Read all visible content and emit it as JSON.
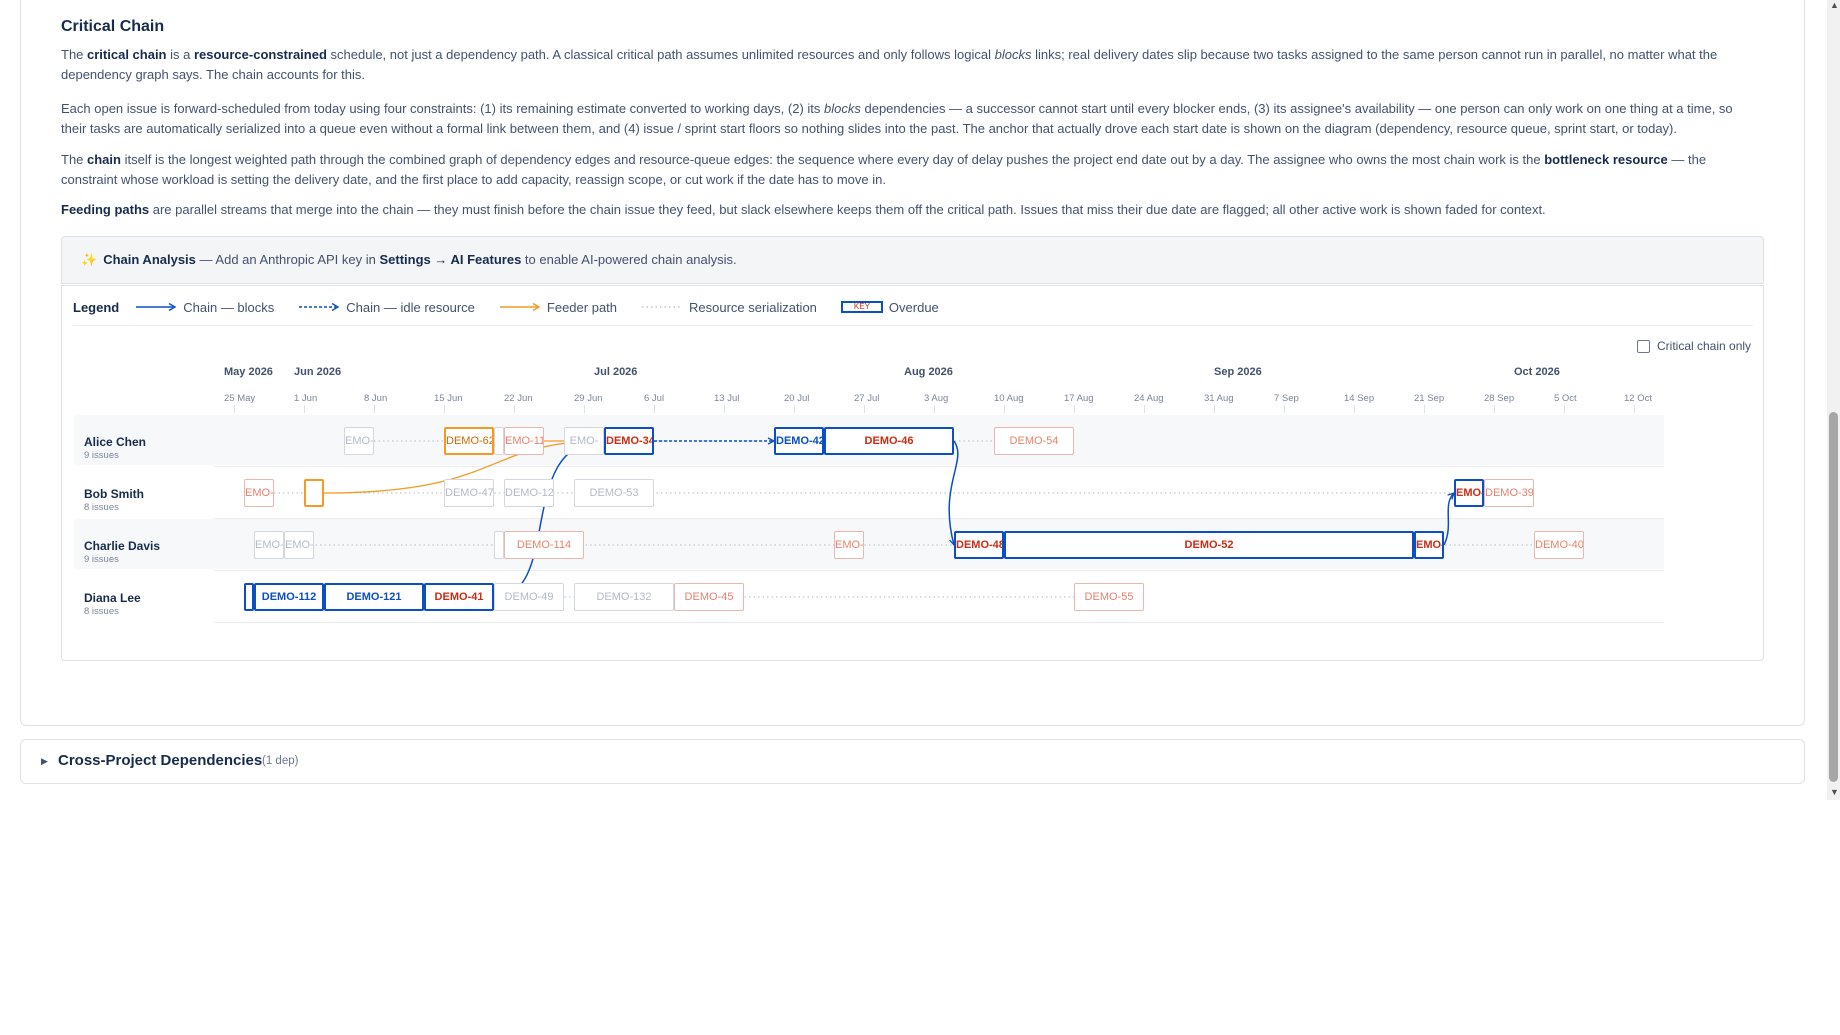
{
  "critical_chain": {
    "title": "Critical Chain",
    "intro": {
      "t1": "The ",
      "b1": "critical chain",
      "t2": " is a ",
      "b2": "resource-constrained",
      "t3": " schedule, not just a dependency path. A classical critical path assumes unlimited resources and only follows logical ",
      "i1": "blocks",
      "t4": " links; real delivery dates slip because two tasks assigned to the same person cannot run in parallel, no matter what the dependency graph says. The chain accounts for this."
    },
    "scheduling": {
      "t1": "Each open issue is forward-scheduled from today using four constraints: (1) its remaining estimate converted to working days, (2) its ",
      "i1": "blocks",
      "t2": " dependencies — a successor cannot start until every blocker ends, (3) its assignee's availability — one person can only work on one thing at a time, so their tasks are automatically serialized into a queue even without a formal link between them, and (4) issue / sprint start floors so nothing slides into the past. The anchor that actually drove each start date is shown on the diagram (dependency, resource queue, sprint start, or today)."
    },
    "chain_para": {
      "t1": "The ",
      "b1": "chain",
      "t2": " itself is the longest weighted path through the combined graph of dependency edges and resource-queue edges: the sequence where every day of delay pushes the project end date out by a day. The assignee who owns the most chain work is the ",
      "b2": "bottleneck resource",
      "t3": " — the constraint whose workload is setting the delivery date, and the first place to add capacity, reassign scope, or cut work if the date has to move in."
    },
    "feeding": {
      "b1": "Feeding paths",
      "t1": " are parallel streams that merge into the chain — they must finish before the chain issue they feed, but slack elsewhere keeps them off the critical path. Issues that miss their due date are flagged; all other active work is shown faded for context."
    }
  },
  "ai_analysis": {
    "icon": "sparkle-icon",
    "title": "Chain Analysis",
    "t1": " — Add an Anthropic API key in ",
    "settings": "Settings → AI Features",
    "t2": " to enable AI-powered chain analysis."
  },
  "legend": {
    "title": "Legend",
    "chain_blocks": "Chain — blocks",
    "chain_idle": "Chain — idle resource",
    "feeder": "Feeder path",
    "serialization": "Resource serialization",
    "overdue_key": "KEY",
    "overdue": "Overdue"
  },
  "critical_only": {
    "label": "Critical chain only",
    "checked": false
  },
  "timeline": {
    "months": [
      {
        "label": "May 2026",
        "date": "2026-05-25"
      },
      {
        "label": "Jun 2026",
        "date": "2026-06-01"
      },
      {
        "label": "Jul 2026",
        "date": "2026-07-01"
      },
      {
        "label": "Aug 2026",
        "date": "2026-08-01"
      },
      {
        "label": "Sep 2026",
        "date": "2026-09-01"
      },
      {
        "label": "Oct 2026",
        "date": "2026-10-01"
      }
    ],
    "weeks": [
      "25 May",
      "1 Jun",
      "8 Jun",
      "15 Jun",
      "22 Jun",
      "29 Jun",
      "6 Jul",
      "13 Jul",
      "20 Jul",
      "27 Jul",
      "3 Aug",
      "10 Aug",
      "17 Aug",
      "24 Aug",
      "31 Aug",
      "7 Sep",
      "14 Sep",
      "21 Sep",
      "28 Sep",
      "5 Oct",
      "12 Oct"
    ]
  },
  "lanes": [
    {
      "name": "Alice Chen",
      "count": "9 issues",
      "bars": [
        {
          "key": "EMO-",
          "start": "2026-06-05",
          "end": "2026-06-08",
          "style": "faded"
        },
        {
          "key": "DEMO-62",
          "start": "2026-06-15",
          "end": "2026-06-20",
          "style": "feeder"
        },
        {
          "key": "",
          "start": "2026-06-20",
          "end": "2026-06-21",
          "style": "faded"
        },
        {
          "key": "EMO-11",
          "start": "2026-06-21",
          "end": "2026-06-25",
          "style": "faded-red"
        },
        {
          "key": "EMO-",
          "start": "2026-06-27",
          "end": "2026-07-01",
          "style": "faded"
        },
        {
          "key": "DEMO-34",
          "start": "2026-07-01",
          "end": "2026-07-06",
          "style": "chain-overdue"
        },
        {
          "key": "DEMO-42",
          "start": "2026-07-18",
          "end": "2026-07-23",
          "style": "chain"
        },
        {
          "key": "DEMO-46",
          "start": "2026-07-23",
          "end": "2026-08-05",
          "style": "chain-overdue"
        },
        {
          "key": "DEMO-54",
          "start": "2026-08-09",
          "end": "2026-08-17",
          "style": "faded-red"
        }
      ]
    },
    {
      "name": "Bob Smith",
      "count": "8 issues",
      "bars": [
        {
          "key": "EMO-",
          "start": "2026-05-26",
          "end": "2026-05-29",
          "style": "faded-red"
        },
        {
          "key": "",
          "start": "2026-06-01",
          "end": "2026-06-03",
          "style": "feeder"
        },
        {
          "key": "DEMO-47",
          "start": "2026-06-15",
          "end": "2026-06-20",
          "style": "faded"
        },
        {
          "key": "DEMO-12",
          "start": "2026-06-21",
          "end": "2026-06-26",
          "style": "faded"
        },
        {
          "key": "DEMO-53",
          "start": "2026-06-28",
          "end": "2026-07-06",
          "style": "faded"
        },
        {
          "key": "EMO-",
          "start": "2026-09-24",
          "end": "2026-09-27",
          "style": "chain-overdue"
        },
        {
          "key": "DEMO-39",
          "start": "2026-09-27",
          "end": "2026-10-02",
          "style": "faded-red"
        }
      ]
    },
    {
      "name": "Charlie Davis",
      "count": "9 issues",
      "bars": [
        {
          "key": "EMO-",
          "start": "2026-05-27",
          "end": "2026-05-30",
          "style": "faded"
        },
        {
          "key": "EMO-1",
          "start": "2026-05-30",
          "end": "2026-06-02",
          "style": "faded"
        },
        {
          "key": "",
          "start": "2026-06-20",
          "end": "2026-06-21",
          "style": "faded"
        },
        {
          "key": "DEMO-114",
          "start": "2026-06-21",
          "end": "2026-06-29",
          "style": "faded-red"
        },
        {
          "key": "EMO-",
          "start": "2026-07-24",
          "end": "2026-07-27",
          "style": "faded-red"
        },
        {
          "key": "DEMO-48",
          "start": "2026-08-05",
          "end": "2026-08-10",
          "style": "chain-overdue"
        },
        {
          "key": "DEMO-52",
          "start": "2026-08-10",
          "end": "2026-09-20",
          "style": "chain-overdue"
        },
        {
          "key": "EMO-",
          "start": "2026-09-20",
          "end": "2026-09-23",
          "style": "chain-overdue"
        },
        {
          "key": "DEMO-40",
          "start": "2026-10-02",
          "end": "2026-10-07",
          "style": "faded-red"
        }
      ]
    },
    {
      "name": "Diana Lee",
      "count": "8 issues",
      "bars": [
        {
          "key": "",
          "start": "2026-05-26",
          "end": "2026-05-27",
          "style": "chain"
        },
        {
          "key": "DEMO-112",
          "start": "2026-05-27",
          "end": "2026-06-03",
          "style": "chain"
        },
        {
          "key": "DEMO-121",
          "start": "2026-06-03",
          "end": "2026-06-13",
          "style": "chain"
        },
        {
          "key": "DEMO-41",
          "start": "2026-06-13",
          "end": "2026-06-20",
          "style": "chain-overdue"
        },
        {
          "key": "DEMO-49",
          "start": "2026-06-20",
          "end": "2026-06-27",
          "style": "faded"
        },
        {
          "key": "DEMO-132",
          "start": "2026-06-28",
          "end": "2026-07-08",
          "style": "faded"
        },
        {
          "key": "DEMO-45",
          "start": "2026-07-08",
          "end": "2026-07-15",
          "style": "faded-red"
        },
        {
          "key": "DEMO-55",
          "start": "2026-08-17",
          "end": "2026-08-24",
          "style": "faded-red"
        }
      ]
    }
  ],
  "cross_project": {
    "title": "Cross-Project Dependencies",
    "count": "(1 dep)",
    "caret_icon": "caret-right-icon"
  },
  "colors": {
    "chain": "#0b4fc2",
    "feeder": "#f59a23",
    "overdue": "#c92d12",
    "serialization": "#b3bac5"
  }
}
